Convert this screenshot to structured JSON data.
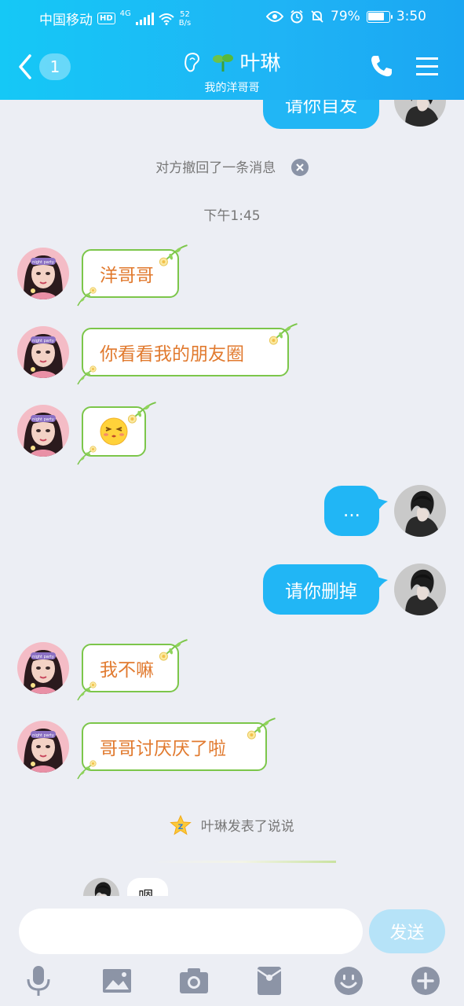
{
  "status_bar": {
    "carrier": "中国移动",
    "hd": "HD",
    "network": "4G",
    "speed_value": "52",
    "speed_unit": "B/s",
    "battery_percent": "79%",
    "battery_level": 0.79,
    "time": "3:50"
  },
  "header": {
    "unread_count": "1",
    "contact_name": "叶琳",
    "subtitle": "我的洋哥哥",
    "icons": [
      "back-arrow-icon",
      "ear-icon",
      "sprout-icon",
      "phone-icon",
      "menu-icon"
    ]
  },
  "chat": {
    "partial_top_message": "请你自发",
    "recall_notice": "对方撤回了一条消息",
    "timestamp": "下午1:45",
    "messages": [
      {
        "side": "in",
        "text": "洋哥哥"
      },
      {
        "side": "in",
        "text": "你看看我的朋友圈"
      },
      {
        "side": "in",
        "text": "emoji",
        "emoji": "laughing-face-icon"
      },
      {
        "side": "out",
        "text": "..."
      },
      {
        "side": "out",
        "text": "请你删掉"
      },
      {
        "side": "in",
        "text": "我不嘛"
      },
      {
        "side": "in",
        "text": "哥哥讨厌厌了啦"
      }
    ],
    "feed_notice": "叶琳发表了说说",
    "partial_bottom_message": "嗯"
  },
  "input_bar": {
    "placeholder": "",
    "send_label": "发送",
    "tools": [
      "microphone-icon",
      "image-icon",
      "camera-icon",
      "red-packet-icon",
      "emoji-icon",
      "plus-icon"
    ]
  },
  "colors": {
    "header_blue": "#1fb4f5",
    "out_bubble": "#21b6f5",
    "in_bubble_border": "#7cc64a",
    "in_text": "#e17a2f",
    "send_disabled": "#b6e3f8"
  }
}
